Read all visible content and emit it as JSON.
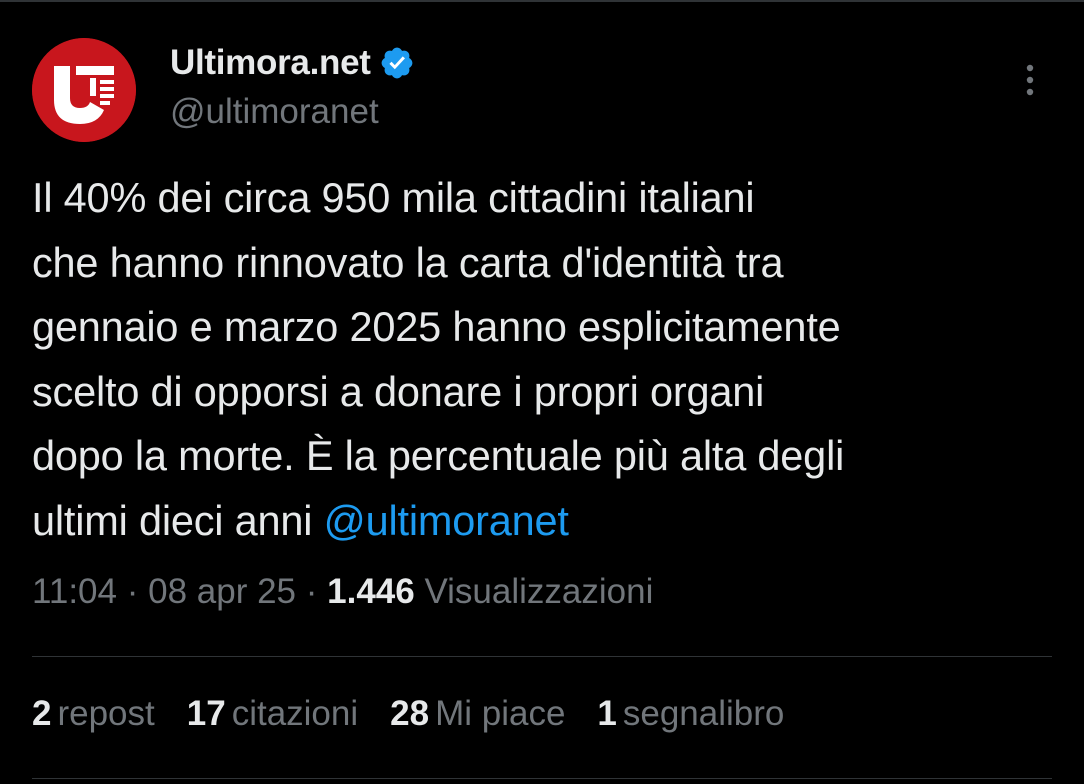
{
  "author": {
    "display_name": "Ultimora.net",
    "handle": "@ultimoranet",
    "verified": true,
    "avatar_icon": "ultimora-logo",
    "avatar_color": "#c8161d"
  },
  "tweet": {
    "lines": [
      "Il 40% dei circa 950 mila cittadini italiani",
      "che hanno rinnovato la carta d'identità tra",
      "gennaio e marzo 2025 hanno esplicitamente",
      "scelto di opporsi a donare i propri organi",
      "dopo la morte. È la percentuale più alta degli"
    ],
    "last_line_text": "ultimi dieci anni ",
    "mention": "@ultimoranet"
  },
  "meta": {
    "time": "11:04",
    "separator": " · ",
    "date": "08 apr 25",
    "views_count": "1.446",
    "views_label": " Visualizzazioni"
  },
  "stats": [
    {
      "count": "2",
      "label": "repost"
    },
    {
      "count": "17",
      "label": "citazioni"
    },
    {
      "count": "28",
      "label": "Mi piace"
    },
    {
      "count": "1",
      "label": "segnalibro"
    }
  ],
  "colors": {
    "background": "#000000",
    "text": "#e7e9ea",
    "secondary": "#71767b",
    "accent": "#1d9bf0",
    "divider": "#2f3336"
  },
  "icons": {
    "verified": "verified-badge-icon",
    "more": "more-vertical-icon"
  }
}
